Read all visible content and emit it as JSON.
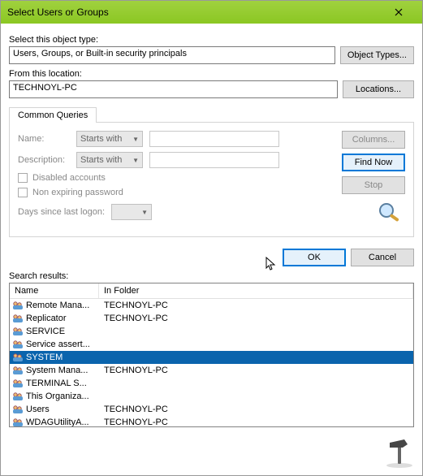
{
  "window": {
    "title": "Select Users or Groups"
  },
  "objectType": {
    "label": "Select this object type:",
    "value": "Users, Groups, or Built-in security principals",
    "button": "Object Types..."
  },
  "location": {
    "label": "From this location:",
    "value": "TECHNOYL-PC",
    "button": "Locations..."
  },
  "tab": {
    "label": "Common Queries"
  },
  "queries": {
    "nameLabel": "Name:",
    "nameMode": "Starts with",
    "descLabel": "Description:",
    "descMode": "Starts with",
    "chkDisabled": "Disabled accounts",
    "chkNonExpire": "Non expiring password",
    "daysLabel": "Days since last logon:",
    "btnColumns": "Columns...",
    "btnFindNow": "Find Now",
    "btnStop": "Stop"
  },
  "footer": {
    "ok": "OK",
    "cancel": "Cancel"
  },
  "results": {
    "label": "Search results:",
    "colName": "Name",
    "colFolder": "In Folder",
    "rows": [
      {
        "name": "Remote Mana...",
        "folder": "TECHNOYL-PC",
        "selected": false
      },
      {
        "name": "Replicator",
        "folder": "TECHNOYL-PC",
        "selected": false
      },
      {
        "name": "SERVICE",
        "folder": "",
        "selected": false
      },
      {
        "name": "Service assert...",
        "folder": "",
        "selected": false
      },
      {
        "name": "SYSTEM",
        "folder": "",
        "selected": true
      },
      {
        "name": "System Mana...",
        "folder": "TECHNOYL-PC",
        "selected": false
      },
      {
        "name": "TERMINAL S...",
        "folder": "",
        "selected": false
      },
      {
        "name": "This Organiza...",
        "folder": "",
        "selected": false
      },
      {
        "name": "Users",
        "folder": "TECHNOYL-PC",
        "selected": false
      },
      {
        "name": "WDAGUtilityA...",
        "folder": "TECHNOYL-PC",
        "selected": false
      }
    ]
  }
}
